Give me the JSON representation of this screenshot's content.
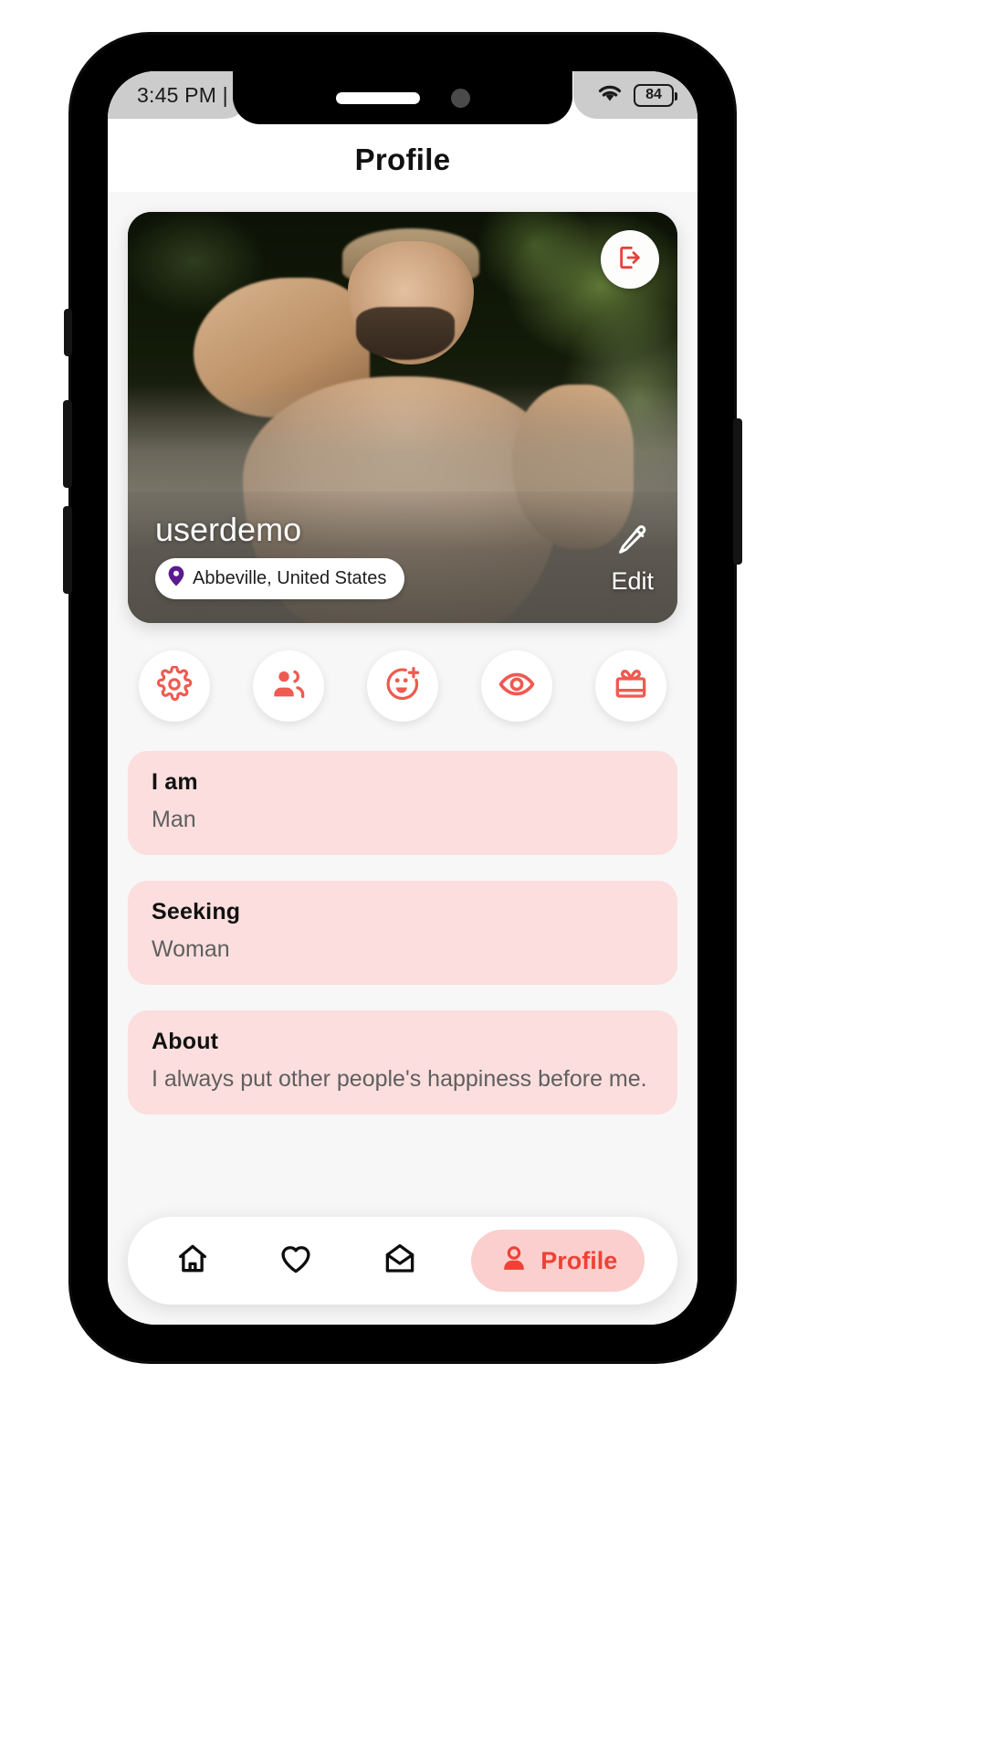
{
  "status_bar": {
    "time": "3:45 PM |",
    "wifi_icon": "wifi-icon",
    "battery_level": "84"
  },
  "header": {
    "title": "Profile"
  },
  "profile_card": {
    "logout_icon": "logout-icon",
    "username": "userdemo",
    "location": "Abbeville, United States",
    "location_icon": "map-pin-icon",
    "edit_icon": "pencil-icon",
    "edit_label": "Edit"
  },
  "action_buttons": [
    {
      "name": "settings",
      "icon": "gear-icon"
    },
    {
      "name": "friends",
      "icon": "people-icon"
    },
    {
      "name": "add-friend",
      "icon": "smiley-plus-icon"
    },
    {
      "name": "visitors",
      "icon": "eye-icon"
    },
    {
      "name": "gifts",
      "icon": "gift-icon"
    }
  ],
  "info_cards": [
    {
      "label": "I am",
      "value": "Man"
    },
    {
      "label": "Seeking",
      "value": "Woman"
    },
    {
      "label": "About",
      "value": "I always put other people's happiness before me."
    }
  ],
  "bottom_nav": [
    {
      "name": "home",
      "icon": "home-icon",
      "label": "",
      "active": false
    },
    {
      "name": "likes",
      "icon": "heart-icon",
      "label": "",
      "active": false
    },
    {
      "name": "messages",
      "icon": "envelope-icon",
      "label": "",
      "active": false
    },
    {
      "name": "profile",
      "icon": "person-icon",
      "label": "Profile",
      "active": true
    }
  ],
  "colors": {
    "accent": "#ef4136",
    "card_pink": "#fbdedd",
    "nav_active_pink": "#fbcfce",
    "pin_purple": "#5b1a8f",
    "screen_bg": "#f7f7f7"
  }
}
